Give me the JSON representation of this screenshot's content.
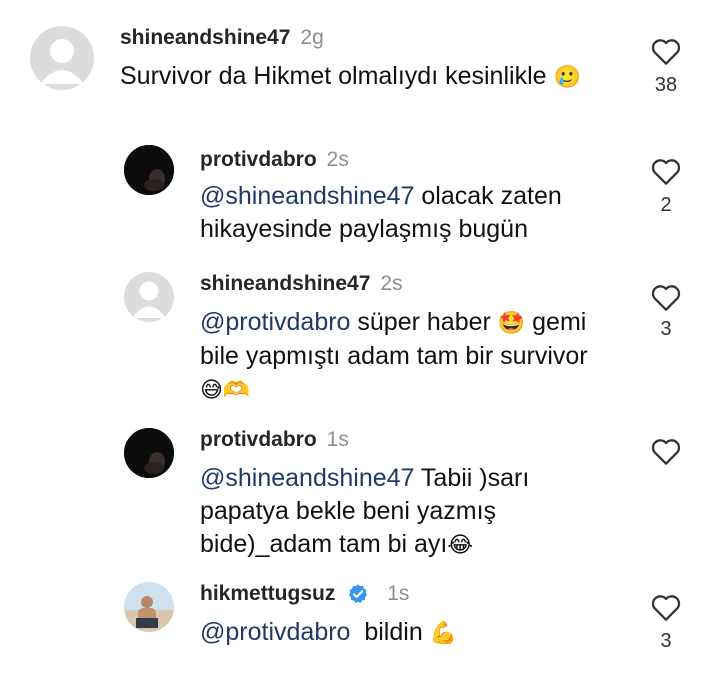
{
  "comments": [
    {
      "username": "shineandshine47",
      "time": "2g",
      "text": "Survivor da Hikmet olmalıydı kesinlikle",
      "emoji": "🥲",
      "likes": "38"
    },
    {
      "username": "protivdabro",
      "time": "2s",
      "mention": "@shineandshine47",
      "text_l1": " olacak zaten",
      "text_l2": "hikayesinde paylaşmış bugün",
      "likes": "2"
    },
    {
      "username": "shineandshine47",
      "time": "2s",
      "mention": "@protivdabro",
      "text_l1": " süper haber ",
      "emoji1": "🤩",
      "text_l1b": " gemi",
      "text_l2": "bile yapmıştı adam tam bir survivor",
      "emoji2": "😅🫶",
      "likes": "3"
    },
    {
      "username": "protivdabro",
      "time": "1s",
      "mention": "@shineandshine47",
      "text_l1": " Tabii )sarı",
      "text_l2": "papatya bekle beni yazmış",
      "text_l3": "bide)_adam tam bi ayı",
      "emoji": "😂"
    },
    {
      "username": "hikmettugsuz",
      "time": "1s",
      "mention": "@protivdabro",
      "text_l1": "  bildin ",
      "emoji": "💪",
      "likes": "3"
    }
  ]
}
